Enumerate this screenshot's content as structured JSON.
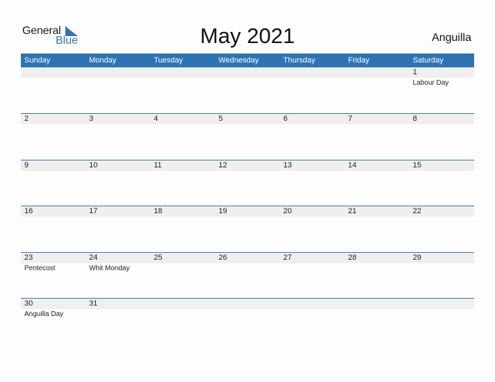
{
  "logo": {
    "line1": "General",
    "line2": "Blue",
    "icon": "triangle-flag-icon",
    "accent": "#2e74b5"
  },
  "header": {
    "title": "May 2021",
    "country": "Anguilla"
  },
  "colors": {
    "header_bg": "#2e74b5",
    "header_text": "#ffffff",
    "strip_bg": "#efefef",
    "separator": "#2e74b5"
  },
  "weekdays": [
    "Sunday",
    "Monday",
    "Tuesday",
    "Wednesday",
    "Thursday",
    "Friday",
    "Saturday"
  ],
  "weeks": [
    [
      {
        "day": "",
        "holiday": ""
      },
      {
        "day": "",
        "holiday": ""
      },
      {
        "day": "",
        "holiday": ""
      },
      {
        "day": "",
        "holiday": ""
      },
      {
        "day": "",
        "holiday": ""
      },
      {
        "day": "",
        "holiday": ""
      },
      {
        "day": "1",
        "holiday": "Labour Day"
      }
    ],
    [
      {
        "day": "2",
        "holiday": ""
      },
      {
        "day": "3",
        "holiday": ""
      },
      {
        "day": "4",
        "holiday": ""
      },
      {
        "day": "5",
        "holiday": ""
      },
      {
        "day": "6",
        "holiday": ""
      },
      {
        "day": "7",
        "holiday": ""
      },
      {
        "day": "8",
        "holiday": ""
      }
    ],
    [
      {
        "day": "9",
        "holiday": ""
      },
      {
        "day": "10",
        "holiday": ""
      },
      {
        "day": "11",
        "holiday": ""
      },
      {
        "day": "12",
        "holiday": ""
      },
      {
        "day": "13",
        "holiday": ""
      },
      {
        "day": "14",
        "holiday": ""
      },
      {
        "day": "15",
        "holiday": ""
      }
    ],
    [
      {
        "day": "16",
        "holiday": ""
      },
      {
        "day": "17",
        "holiday": ""
      },
      {
        "day": "18",
        "holiday": ""
      },
      {
        "day": "19",
        "holiday": ""
      },
      {
        "day": "20",
        "holiday": ""
      },
      {
        "day": "21",
        "holiday": ""
      },
      {
        "day": "22",
        "holiday": ""
      }
    ],
    [
      {
        "day": "23",
        "holiday": "Pentecost"
      },
      {
        "day": "24",
        "holiday": "Whit Monday"
      },
      {
        "day": "25",
        "holiday": ""
      },
      {
        "day": "26",
        "holiday": ""
      },
      {
        "day": "27",
        "holiday": ""
      },
      {
        "day": "28",
        "holiday": ""
      },
      {
        "day": "29",
        "holiday": ""
      }
    ],
    [
      {
        "day": "30",
        "holiday": "Anguilla Day"
      },
      {
        "day": "31",
        "holiday": ""
      },
      {
        "day": "",
        "holiday": ""
      },
      {
        "day": "",
        "holiday": ""
      },
      {
        "day": "",
        "holiday": ""
      },
      {
        "day": "",
        "holiday": ""
      },
      {
        "day": "",
        "holiday": ""
      }
    ]
  ]
}
